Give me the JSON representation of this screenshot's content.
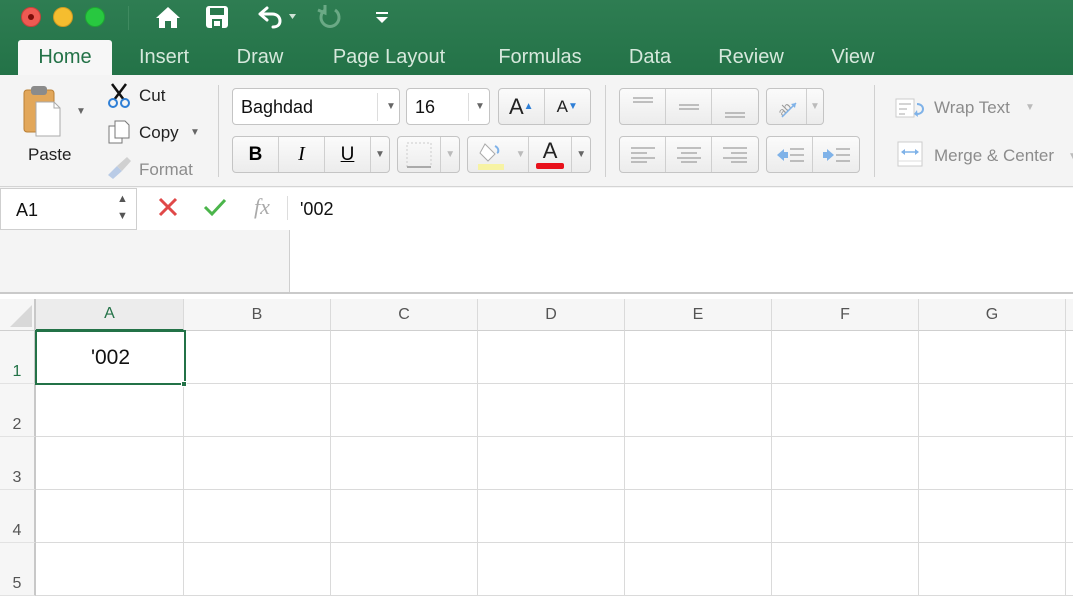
{
  "window": {
    "traffic_lights": [
      "close",
      "minimize",
      "zoom"
    ],
    "quick_access": [
      {
        "name": "home-icon"
      },
      {
        "name": "save-icon"
      },
      {
        "name": "undo-icon"
      },
      {
        "name": "redo-icon"
      },
      {
        "name": "customize-toolbar-icon"
      }
    ]
  },
  "tabs": [
    {
      "label": "Home",
      "active": true
    },
    {
      "label": "Insert"
    },
    {
      "label": "Draw"
    },
    {
      "label": "Page Layout"
    },
    {
      "label": "Formulas"
    },
    {
      "label": "Data"
    },
    {
      "label": "Review"
    },
    {
      "label": "View"
    }
  ],
  "ribbon": {
    "clipboard": {
      "paste": "Paste",
      "cut": "Cut",
      "copy": "Copy",
      "format": "Format"
    },
    "font": {
      "name": "Baghdad",
      "size": "16",
      "bold": "B",
      "italic": "I",
      "underline": "U",
      "grow": "A",
      "shrink": "A",
      "font_color": "A"
    },
    "colors": {
      "highlight": "#f7f3a4",
      "font_color": "#e8111b",
      "accent": "#237247"
    },
    "alignment": {
      "wrap_text": "Wrap Text",
      "merge_center": "Merge & Center"
    }
  },
  "formula_bar": {
    "cell_ref": "A1",
    "fx": "fx",
    "content": "'002"
  },
  "sheet": {
    "columns": [
      "A",
      "B",
      "C",
      "D",
      "E",
      "F",
      "G"
    ],
    "rows": [
      "1",
      "2",
      "3",
      "4",
      "5"
    ],
    "selected": "A1",
    "cells": {
      "A1": "'002"
    }
  }
}
